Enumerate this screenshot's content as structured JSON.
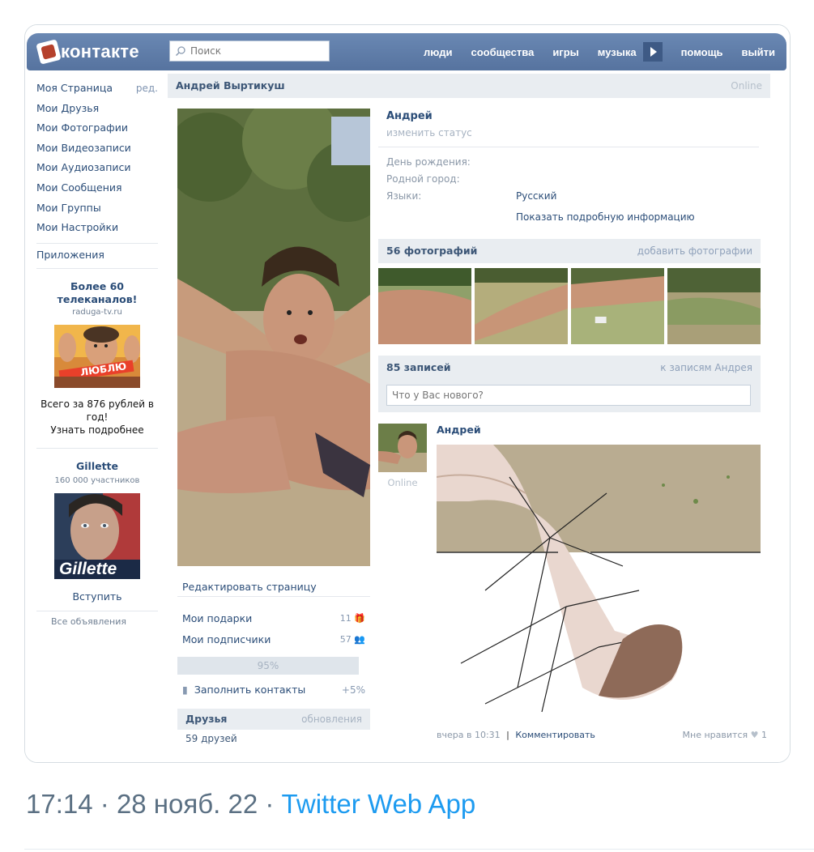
{
  "header": {
    "logo_text": "контакте",
    "search_placeholder": "Поиск",
    "nav": [
      "люди",
      "сообщества",
      "игры",
      "музыка",
      "помощь",
      "выйти"
    ]
  },
  "sidebar": {
    "items": [
      {
        "label": "Моя Страница",
        "extra": "ред."
      },
      {
        "label": "Мои Друзья"
      },
      {
        "label": "Мои Фотографии"
      },
      {
        "label": "Мои Видеозаписи"
      },
      {
        "label": "Мои Аудиозаписи"
      },
      {
        "label": "Мои Сообщения"
      },
      {
        "label": "Мои Группы"
      },
      {
        "label": "Мои Настройки"
      }
    ],
    "apps_label": "Приложения",
    "ad1": {
      "title": "Более 60 телеканалов!",
      "domain": "raduga-tv.ru",
      "badge": "ЛЮБЛЮ",
      "text": "Всего за 876 рублей в год!",
      "more": "Узнать подробнее"
    },
    "ad2": {
      "title": "Gillette",
      "members": "160 000 участников",
      "brand": "Gillette",
      "join": "Вступить"
    },
    "all_ads": "Все объявления"
  },
  "profile": {
    "full_name": "Андрей Выртикуш",
    "online": "Online",
    "first_name": "Андрей",
    "status_link": "изменить статус",
    "info": [
      {
        "key": "День рождения:",
        "value": ""
      },
      {
        "key": "Родной город:",
        "value": ""
      },
      {
        "key": "Языки:",
        "value": "Русский"
      }
    ],
    "show_more": "Показать подробную информацию"
  },
  "left_column": {
    "edit_page": "Редактировать страницу",
    "gifts": {
      "label": "Мои подарки",
      "count": "11"
    },
    "subscribers": {
      "label": "Мои подписчики",
      "count": "57"
    },
    "progress": "95%",
    "fill_contacts": {
      "label": "Заполнить контакты",
      "plus": "+5%"
    },
    "friends": {
      "title": "Друзья",
      "updates": "обновления",
      "count": "59 друзей"
    }
  },
  "photos": {
    "title": "56 фотографий",
    "add": "добавить фотографии"
  },
  "wall": {
    "title": "85 записей",
    "to_posts": "к записям Андрея",
    "input_placeholder": "Что у Вас нового?"
  },
  "post": {
    "author": "Андрей",
    "online": "Online",
    "time": "вчера в 10:31",
    "separator": "|",
    "comment": "Комментировать",
    "like": "Мне нравится",
    "like_count": "1"
  },
  "tweet": {
    "time": "17:14",
    "dot": "·",
    "date": "28 нояб. 22",
    "app": "Twitter Web App"
  }
}
